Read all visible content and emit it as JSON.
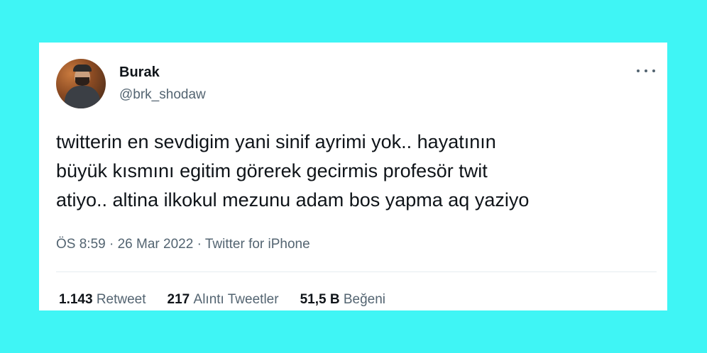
{
  "tweet": {
    "display_name": "Burak",
    "handle": "@brk_shodaw",
    "text": "twitterin en sevdigim yani sinif ayrimi yok.. hayatının\nbüyük kısmını egitim görerek gecirmis profesör twit\natiyo.. altina ilkokul mezunu adam bos yapma aq yaziyo",
    "time": "ÖS 8:59",
    "date": "26 Mar 2022",
    "source": "Twitter for iPhone",
    "separator": "·"
  },
  "stats": {
    "retweets_count": "1.143",
    "retweets_label": "Retweet",
    "quotes_count": "217",
    "quotes_label": "Alıntı Tweetler",
    "likes_count": "51,5 B",
    "likes_label": "Beğeni"
  },
  "icons": {
    "more": "more-options-icon"
  },
  "colors": {
    "background": "#3ff5f5",
    "card": "#ffffff",
    "primary_text": "#0f1419",
    "secondary_text": "#536471"
  }
}
